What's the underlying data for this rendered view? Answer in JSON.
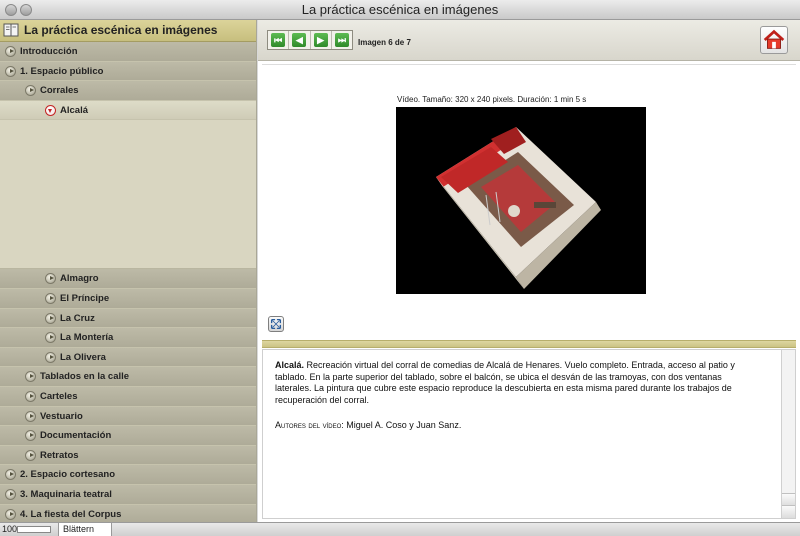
{
  "window": {
    "title": "La práctica escénica en imágenes"
  },
  "sidebar": {
    "header": "La práctica escénica en imágenes",
    "items": [
      {
        "label": "Introducción",
        "level": 0,
        "active": false
      },
      {
        "label": "1. Espacio público",
        "level": 0,
        "active": false
      },
      {
        "label": "Corrales",
        "level": 1,
        "active": false
      },
      {
        "label": "Alcalá",
        "level": 2,
        "active": true
      },
      {
        "label": "Almagro",
        "level": 2,
        "active": false
      },
      {
        "label": "El Príncipe",
        "level": 2,
        "active": false
      },
      {
        "label": "La Cruz",
        "level": 2,
        "active": false
      },
      {
        "label": "La Montería",
        "level": 2,
        "active": false
      },
      {
        "label": "La Olivera",
        "level": 2,
        "active": false
      },
      {
        "label": "Tablados en la calle",
        "level": 1,
        "active": false
      },
      {
        "label": "Carteles",
        "level": 1,
        "active": false
      },
      {
        "label": "Vestuario",
        "level": 1,
        "active": false
      },
      {
        "label": "Documentación",
        "level": 1,
        "active": false
      },
      {
        "label": "Retratos",
        "level": 1,
        "active": false
      },
      {
        "label": "2. Espacio cortesano",
        "level": 0,
        "active": false
      },
      {
        "label": "3. Maquinaria teatral",
        "level": 0,
        "active": false
      },
      {
        "label": "4. La fiesta del Corpus",
        "level": 0,
        "active": false
      }
    ]
  },
  "toolbar": {
    "image_counter": "Imagen 6 de 7",
    "nav_buttons": [
      "first-icon",
      "prev-icon",
      "next-icon",
      "last-icon"
    ],
    "home_icon": "home-icon"
  },
  "media": {
    "info": "Vídeo. Tamaño: 320 x 240 pixels. Duración: 1 min 5 s"
  },
  "description": {
    "title": "Alcalá.",
    "text": " Recreación virtual del corral de comedias de Alcalá de Henares. Vuelo completo. Entrada, acceso al patio y tablado. En la parte superior del tablado, sobre el balcón, se ubica el desván de las tramoyas, con dos ventanas laterales. La pintura que cubre este espacio reproduce la descubierta en esta misma pared durante los trabajos de recuperación del corral.",
    "authors_label": "Autores del vídeo",
    "authors": ": Miguel A. Coso y Juan Sanz."
  },
  "statusbar": {
    "zoom": "100",
    "mode": "Blättern"
  },
  "colors": {
    "accent_green": "#2f8a2a",
    "active_red": "#c42424",
    "header_tan": "#c7bf7e"
  }
}
